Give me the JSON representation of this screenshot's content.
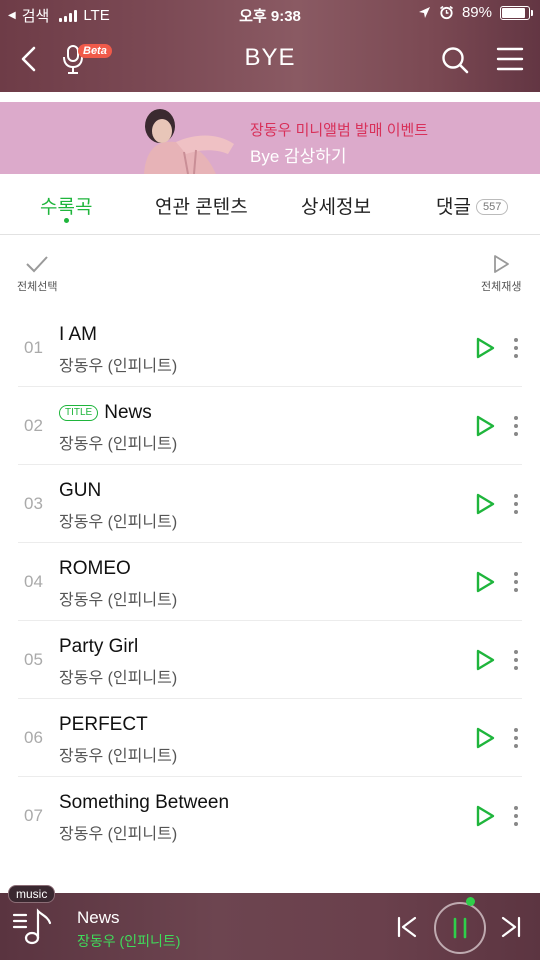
{
  "status_bar": {
    "carrier_back": "검색",
    "network": "LTE",
    "time": "오후 9:38",
    "battery_text": "89%",
    "battery_level": 0.89
  },
  "nav": {
    "title": "BYE",
    "beta_label": "Beta"
  },
  "banner": {
    "line1": "장동우 미니앨범 발매 이벤트",
    "line2": "Bye 감상하기"
  },
  "tabs": [
    {
      "label": "수록곡",
      "active": true
    },
    {
      "label": "연관 콘텐츠",
      "active": false
    },
    {
      "label": "상세정보",
      "active": false
    },
    {
      "label": "댓글",
      "active": false,
      "count": "557"
    }
  ],
  "actions": {
    "select_all": "전체선택",
    "play_all": "전체재생"
  },
  "title_tag": "TITLE",
  "tracks": [
    {
      "num": "01",
      "title": "I AM",
      "artist": "장동우 (인피니트)",
      "is_title": false
    },
    {
      "num": "02",
      "title": "News",
      "artist": "장동우 (인피니트)",
      "is_title": true
    },
    {
      "num": "03",
      "title": "GUN",
      "artist": "장동우 (인피니트)",
      "is_title": false
    },
    {
      "num": "04",
      "title": "ROMEO",
      "artist": "장동우 (인피니트)",
      "is_title": false
    },
    {
      "num": "05",
      "title": "Party Girl",
      "artist": "장동우 (인피니트)",
      "is_title": false
    },
    {
      "num": "06",
      "title": "PERFECT",
      "artist": "장동우 (인피니트)",
      "is_title": false
    },
    {
      "num": "07",
      "title": "Something Between",
      "artist": "장동우 (인피니트)",
      "is_title": false
    }
  ],
  "player": {
    "tag": "music",
    "title": "News",
    "artist": "장동우 (인피니트)",
    "state": "playing"
  },
  "colors": {
    "accent_green": "#1fb53c",
    "header_bg": "#7c4a55",
    "banner_bg": "#dcaacb",
    "banner_highlight": "#d8315a",
    "player_bg": "#6d4550"
  },
  "icons": {
    "back": "chevron-left-icon",
    "mic": "microphone-icon",
    "search": "search-icon",
    "menu": "hamburger-menu-icon",
    "select_all": "checkmark-icon",
    "play_all": "play-outline-icon",
    "track_play": "play-icon",
    "track_more": "more-vertical-icon",
    "playlist": "playlist-note-icon",
    "prev": "skip-previous-icon",
    "pause": "pause-icon",
    "next": "skip-next-icon"
  }
}
